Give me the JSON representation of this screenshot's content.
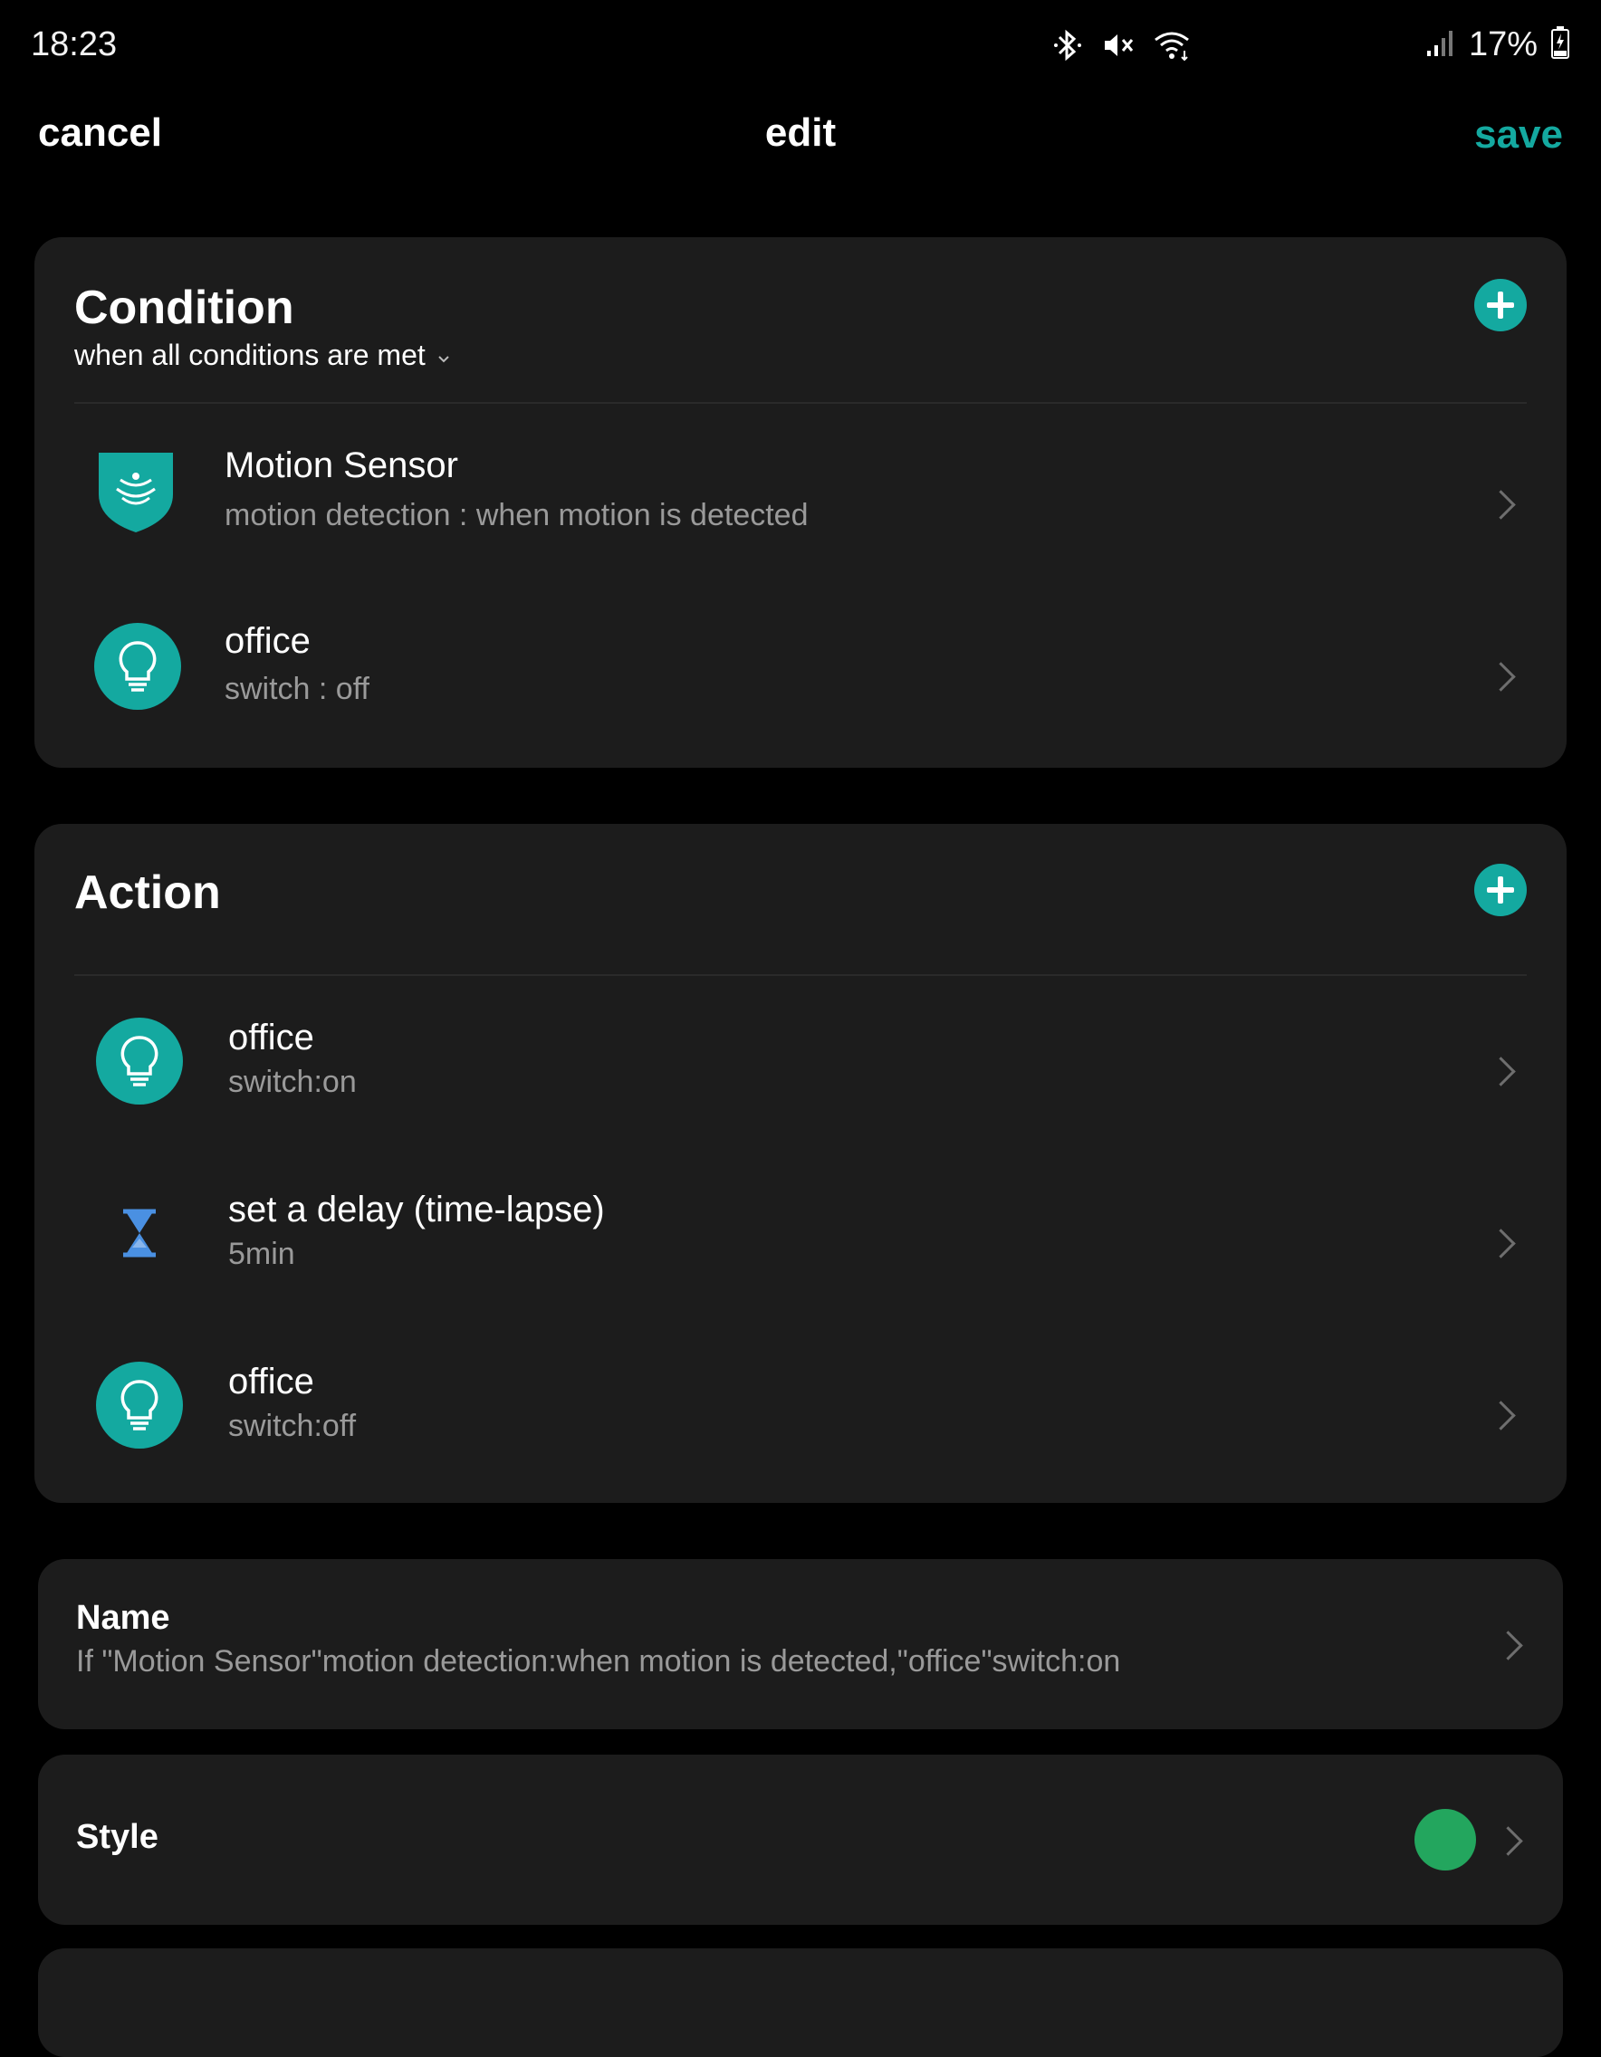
{
  "status_bar": {
    "time": "18:23",
    "battery": "17%",
    "icons": [
      "bluetooth-icon",
      "mute-icon",
      "wifi-icon",
      "signal-icon",
      "battery-charging-icon"
    ]
  },
  "header": {
    "cancel": "cancel",
    "title": "edit",
    "save": "save"
  },
  "condition": {
    "title": "Condition",
    "mode": "when all conditions are met",
    "items": [
      {
        "icon": "motion-sensor-icon",
        "title": "Motion Sensor",
        "subtitle": "motion detection : when motion is detected"
      },
      {
        "icon": "light-bulb-icon",
        "title": "office",
        "subtitle": "switch : off"
      }
    ]
  },
  "action": {
    "title": "Action",
    "items": [
      {
        "icon": "light-bulb-icon",
        "title": "office",
        "subtitle": "switch:on"
      },
      {
        "icon": "hourglass-icon",
        "title": "set a delay (time-lapse)",
        "subtitle": "5min"
      },
      {
        "icon": "light-bulb-icon",
        "title": "office",
        "subtitle": "switch:off"
      }
    ]
  },
  "name_section": {
    "label": "Name",
    "value": "If \"Motion Sensor\"motion detection:when motion is detected,\"office\"switch:on"
  },
  "style_section": {
    "label": "Style",
    "color": "#23a65e"
  },
  "colors": {
    "accent": "#14a9a0",
    "hourglass": "#4a90e2"
  }
}
